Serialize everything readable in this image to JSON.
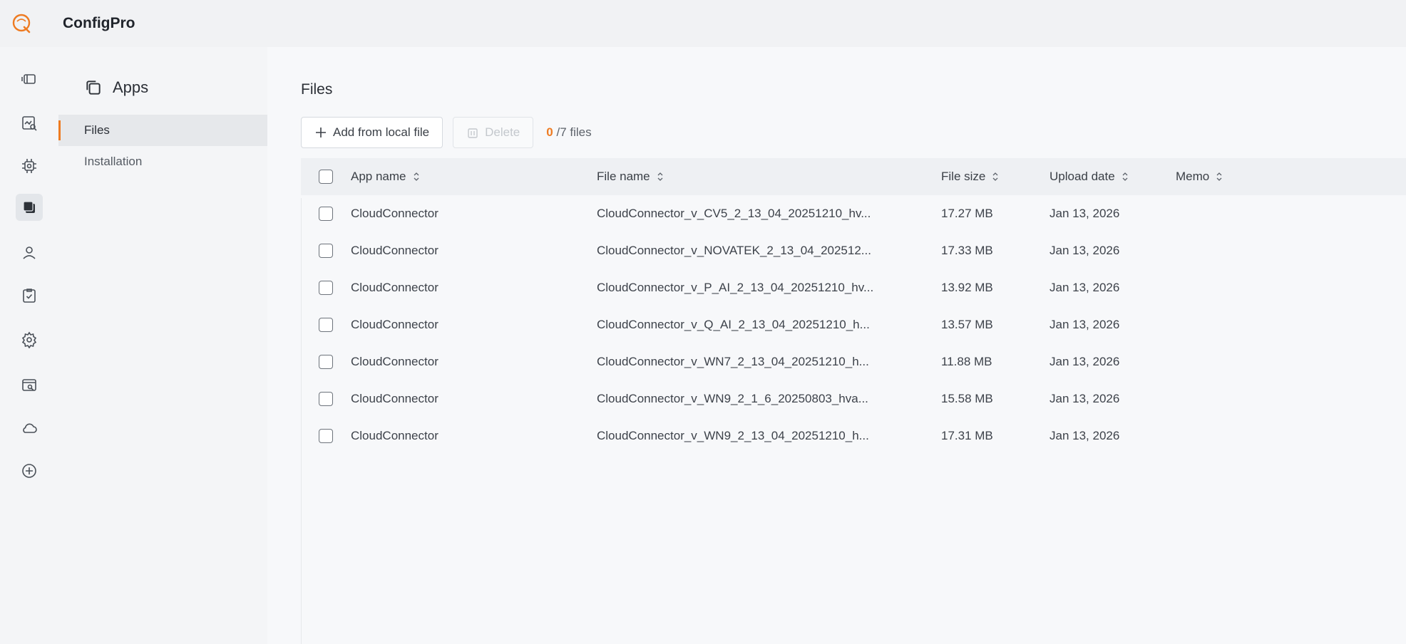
{
  "app": {
    "title": "ConfigPro"
  },
  "rail": {
    "icons": [
      "panel-icon",
      "chart-search-icon",
      "chip-icon",
      "apps-icon",
      "user-icon",
      "clipboard-check-icon",
      "gear-icon",
      "server-search-icon",
      "cloud-icon",
      "plus-circle-icon"
    ],
    "active": "apps-icon"
  },
  "subnav": {
    "header": "Apps",
    "items": [
      {
        "label": "Files",
        "active": true
      },
      {
        "label": "Installation",
        "active": false
      }
    ]
  },
  "main": {
    "title": "Files",
    "toolbar": {
      "add_label": "Add from local file",
      "delete_label": "Delete",
      "selected_count": "0",
      "total_label": "/7 files"
    },
    "table": {
      "columns": [
        "App name",
        "File name",
        "File size",
        "Upload date",
        "Memo"
      ],
      "rows": [
        {
          "app": "CloudConnector",
          "file": "CloudConnector_v_CV5_2_13_04_20251210_hv...",
          "size": "17.27 MB",
          "date": "Jan 13, 2026",
          "memo": ""
        },
        {
          "app": "CloudConnector",
          "file": "CloudConnector_v_NOVATEK_2_13_04_202512...",
          "size": "17.33 MB",
          "date": "Jan 13, 2026",
          "memo": ""
        },
        {
          "app": "CloudConnector",
          "file": "CloudConnector_v_P_AI_2_13_04_20251210_hv...",
          "size": "13.92 MB",
          "date": "Jan 13, 2026",
          "memo": ""
        },
        {
          "app": "CloudConnector",
          "file": "CloudConnector_v_Q_AI_2_13_04_20251210_h...",
          "size": "13.57 MB",
          "date": "Jan 13, 2026",
          "memo": ""
        },
        {
          "app": "CloudConnector",
          "file": "CloudConnector_v_WN7_2_13_04_20251210_h...",
          "size": "11.88 MB",
          "date": "Jan 13, 2026",
          "memo": ""
        },
        {
          "app": "CloudConnector",
          "file": "CloudConnector_v_WN9_2_1_6_20250803_hva...",
          "size": "15.58 MB",
          "date": "Jan 13, 2026",
          "memo": ""
        },
        {
          "app": "CloudConnector",
          "file": "CloudConnector_v_WN9_2_13_04_20251210_h...",
          "size": "17.31 MB",
          "date": "Jan 13, 2026",
          "memo": ""
        }
      ]
    }
  },
  "colors": {
    "accent": "#ee7b22"
  }
}
